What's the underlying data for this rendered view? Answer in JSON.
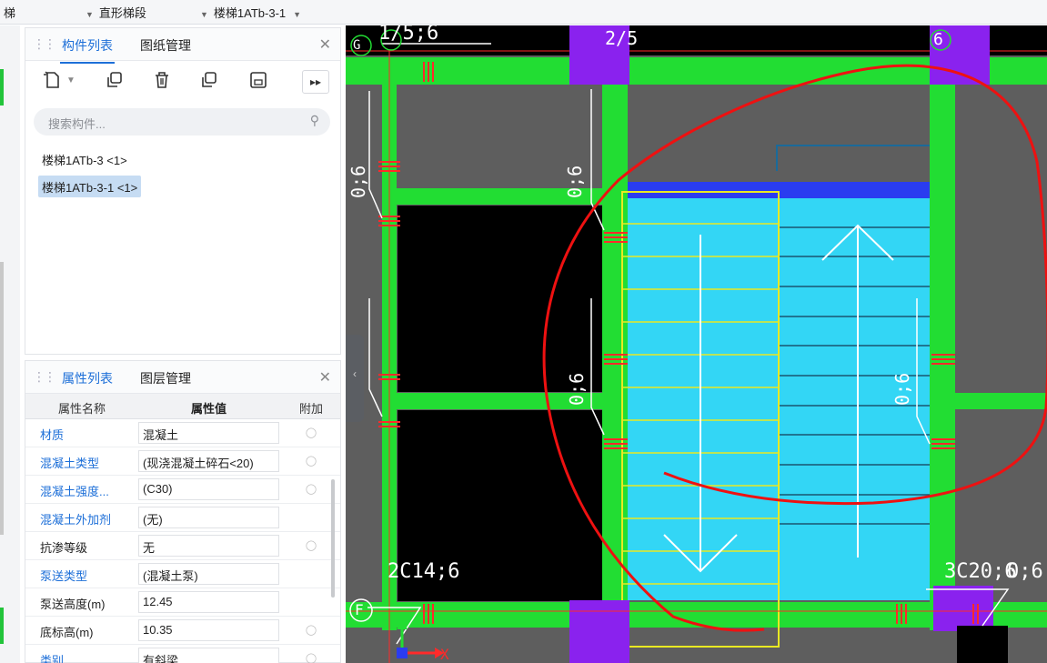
{
  "toolbar": {
    "left_fragment": "梯",
    "dropdown_type": "直形梯段",
    "dropdown_component": "楼梯1ATb-3-1"
  },
  "component_panel": {
    "tabs": [
      {
        "label": "构件列表",
        "active": true
      },
      {
        "label": "图纸管理",
        "active": false
      }
    ],
    "search_placeholder": "搜索构件...",
    "items": [
      {
        "label": "楼梯1ATb-3 <1>",
        "selected": false
      },
      {
        "label": "楼梯1ATb-3-1 <1>",
        "selected": true
      }
    ],
    "tool_icons": [
      "new-icon",
      "copy-icon",
      "delete-icon",
      "copy-layer-icon",
      "save-icon",
      "more-icon"
    ]
  },
  "property_panel": {
    "tabs": [
      {
        "label": "属性列表",
        "active": true
      },
      {
        "label": "图层管理",
        "active": false
      }
    ],
    "columns": [
      "属性名称",
      "属性值",
      "附加"
    ],
    "rows": [
      {
        "name": "材质",
        "value": "混凝土",
        "link": true,
        "extra": true
      },
      {
        "name": "混凝土类型",
        "value": "(现浇混凝土碎石<20)",
        "link": true,
        "extra": true
      },
      {
        "name": "混凝土强度...",
        "value": "(C30)",
        "link": true,
        "extra": true
      },
      {
        "name": "混凝土外加剂",
        "value": "(无)",
        "link": true,
        "extra": false
      },
      {
        "name": "抗渗等级",
        "value": "无",
        "link": false,
        "extra": true
      },
      {
        "name": "泵送类型",
        "value": "(混凝土泵)",
        "link": true,
        "extra": false
      },
      {
        "name": "泵送高度(m)",
        "value": "12.45",
        "link": false,
        "extra": false
      },
      {
        "name": "底标高(m)",
        "value": "10.35",
        "link": false,
        "extra": true
      },
      {
        "name": "类别",
        "value": "有斜梁",
        "link": true,
        "extra": true
      }
    ]
  },
  "cad": {
    "axis_labels": {
      "top_left_circle": "G",
      "top_left_text": "1/5;6",
      "top_mid": "2/5",
      "top_right_circle": "6",
      "bottom_left_circle": "F",
      "axis_x": "X"
    },
    "beam_labels": {
      "left_bottom": "2C14;6",
      "right_bottom": "3C20;6",
      "right_bottom_overlap": "0;6",
      "vertical_1": "0;6",
      "vertical_2": "0;6",
      "vertical_3": "0;6",
      "vertical_4": "0;6"
    },
    "colors": {
      "beam_green": "#22dd33",
      "slab_gray": "#5e5e5e",
      "stair_cyan": "#33d6f5",
      "column_purple": "#8a22ee",
      "rebar_red": "#ff2a2a",
      "annotation_red": "#ee1111",
      "stair_outline_yellow": "#e9e922"
    }
  }
}
